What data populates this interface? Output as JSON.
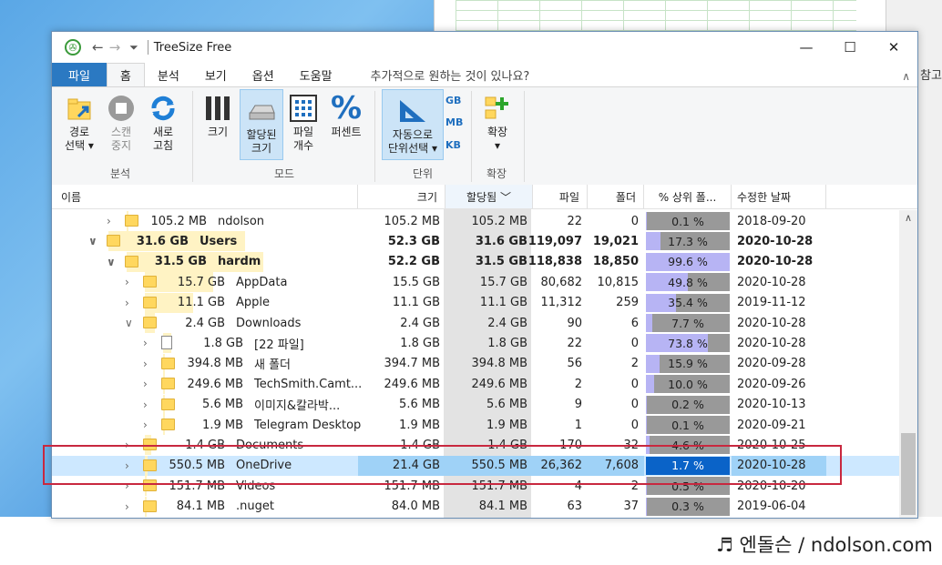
{
  "window": {
    "title": "TreeSize Free"
  },
  "tabs": [
    "파일",
    "홈",
    "분석",
    "보기",
    "옵션",
    "도움말"
  ],
  "tell_me": "추가적으로 원하는 것이 있나요?",
  "peek_text": "참고",
  "ribbon": {
    "analysis": {
      "path_l1": "경로",
      "path_l2": "선택 ▾",
      "scan_l1": "스캔",
      "scan_l2": "중지",
      "refresh_l1": "새로",
      "refresh_l2": "고침",
      "group": "분석"
    },
    "mode": {
      "size": "크기",
      "alloc_l1": "할당된",
      "alloc_l2": "크기",
      "files_l1": "파일",
      "files_l2": "개수",
      "percent": "퍼센트",
      "group": "모드"
    },
    "unit": {
      "auto_l1": "자동으로",
      "auto_l2": "단위선택 ▾",
      "gb": "GB",
      "mb": "MB",
      "kb": "KB",
      "group": "단위"
    },
    "expand": {
      "label_l1": "확장",
      "label_l2": "▾",
      "group": "확장"
    }
  },
  "columns": {
    "name": "이름",
    "size": "크기",
    "alloc": "할당됨 ﹀",
    "files": "파일",
    "folders": "폴더",
    "pct": "% 상위 폴...",
    "date": "수정한 날짜"
  },
  "rows": [
    {
      "alloc_label": "105.2 MB",
      "name": "ndolson",
      "size": "105.2 MB",
      "alloc": "105.2 MB",
      "files": "22",
      "folders": "0",
      "pct": 0.1,
      "pct_text": "0.1 %",
      "date": "2018-09-20"
    },
    {
      "alloc_label": "31.6 GB",
      "name": "Users",
      "size": "52.3 GB",
      "alloc": "31.6 GB",
      "files": "119,097",
      "folders": "19,021",
      "pct": 17.3,
      "pct_text": "17.3 %",
      "date": "2020-10-28"
    },
    {
      "alloc_label": "31.5 GB",
      "name": "hardm",
      "size": "52.2 GB",
      "alloc": "31.5 GB",
      "files": "118,838",
      "folders": "18,850",
      "pct": 99.6,
      "pct_text": "99.6 %",
      "date": "2020-10-28"
    },
    {
      "alloc_label": "15.7 GB",
      "name": "AppData",
      "size": "15.5 GB",
      "alloc": "15.7 GB",
      "files": "80,682",
      "folders": "10,815",
      "pct": 49.8,
      "pct_text": "49.8 %",
      "date": "2020-10-28"
    },
    {
      "alloc_label": "11.1 GB",
      "name": "Apple",
      "size": "11.1 GB",
      "alloc": "11.1 GB",
      "files": "11,312",
      "folders": "259",
      "pct": 35.4,
      "pct_text": "35.4 %",
      "date": "2019-11-12"
    },
    {
      "alloc_label": "2.4 GB",
      "name": "Downloads",
      "size": "2.4 GB",
      "alloc": "2.4 GB",
      "files": "90",
      "folders": "6",
      "pct": 7.7,
      "pct_text": "7.7 %",
      "date": "2020-10-28"
    },
    {
      "alloc_label": "1.8 GB",
      "name": "[22 파일]",
      "size": "1.8 GB",
      "alloc": "1.8 GB",
      "files": "22",
      "folders": "0",
      "pct": 73.8,
      "pct_text": "73.8 %",
      "date": "2020-10-28"
    },
    {
      "alloc_label": "394.8 MB",
      "name": "새 폴더",
      "size": "394.7 MB",
      "alloc": "394.8 MB",
      "files": "56",
      "folders": "2",
      "pct": 15.9,
      "pct_text": "15.9 %",
      "date": "2020-09-28"
    },
    {
      "alloc_label": "249.6 MB",
      "name": "TechSmith.Camt...",
      "size": "249.6 MB",
      "alloc": "249.6 MB",
      "files": "2",
      "folders": "0",
      "pct": 10.0,
      "pct_text": "10.0 %",
      "date": "2020-09-26"
    },
    {
      "alloc_label": "5.6 MB",
      "name": "이미지&칼라박...",
      "size": "5.6 MB",
      "alloc": "5.6 MB",
      "files": "9",
      "folders": "0",
      "pct": 0.2,
      "pct_text": "0.2 %",
      "date": "2020-10-13"
    },
    {
      "alloc_label": "1.9 MB",
      "name": "Telegram Desktop",
      "size": "1.9 MB",
      "alloc": "1.9 MB",
      "files": "1",
      "folders": "0",
      "pct": 0.1,
      "pct_text": "0.1 %",
      "date": "2020-09-21"
    },
    {
      "alloc_label": "1.4 GB",
      "name": "Documents",
      "size": "1.4 GB",
      "alloc": "1.4 GB",
      "files": "170",
      "folders": "32",
      "pct": 4.6,
      "pct_text": "4.6 %",
      "date": "2020-10-25"
    },
    {
      "alloc_label": "550.5 MB",
      "name": "OneDrive",
      "size": "21.4 GB",
      "alloc": "550.5 MB",
      "files": "26,362",
      "folders": "7,608",
      "pct": 1.7,
      "pct_text": "1.7 %",
      "date": "2020-10-28"
    },
    {
      "alloc_label": "151.7 MB",
      "name": "Videos",
      "size": "151.7 MB",
      "alloc": "151.7 MB",
      "files": "4",
      "folders": "2",
      "pct": 0.5,
      "pct_text": "0.5 %",
      "date": "2020-10-20"
    },
    {
      "alloc_label": "84.1 MB",
      "name": ".nuget",
      "size": "84.0 MB",
      "alloc": "84.1 MB",
      "files": "63",
      "folders": "37",
      "pct": 0.3,
      "pct_text": "0.3 %",
      "date": "2019-06-04"
    }
  ],
  "credit": "♬ 엔돌슨 / ndolson.com",
  "colors": {
    "file_tab": "#2b79c2",
    "highlight": "#cde8ff",
    "pct_fill": "#b7b4f4",
    "selected_pct": "#0a63c8",
    "red_box": "#c8283f"
  }
}
